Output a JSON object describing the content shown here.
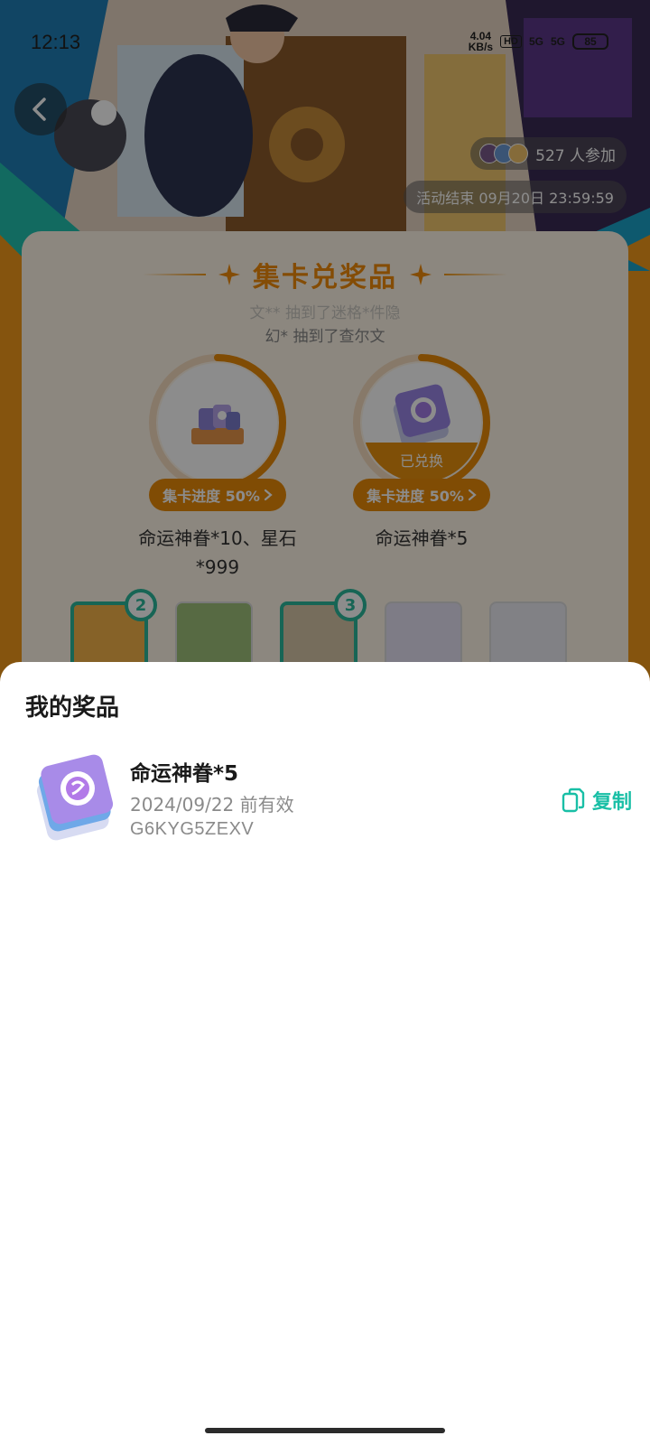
{
  "status_bar": {
    "time": "12:13",
    "net_speed": "4.04",
    "net_unit": "KB/s",
    "hd": "HD",
    "signal1": "5G",
    "signal2": "5G",
    "battery": "85"
  },
  "header": {
    "participants": "527 人参加",
    "end_time": "活动结束 09月20日 23:59:59"
  },
  "card": {
    "title": "集卡兑奖品",
    "marquee_line1": "文** 抽到了迷格*件隐",
    "marquee_line2": "幻* 抽到了查尔文",
    "prizes": [
      {
        "progress": "集卡进度 50%",
        "name": "命运神眷*10、星石*999",
        "fill": 0.5,
        "redeemed": ""
      },
      {
        "progress": "集卡进度 50%",
        "name": "命运神眷*5",
        "fill": 0.5,
        "redeemed": "已兑换"
      }
    ],
    "thumb_badges": [
      "2",
      "3"
    ]
  },
  "sheet": {
    "title": "我的奖品",
    "item": {
      "name": "命运神眷*5",
      "expiry": "2024/09/22 前有效",
      "code": "G6KYG5ZEXV",
      "copy_label": "复制"
    }
  },
  "colors": {
    "accent_orange": "#f08a0a",
    "accent_teal": "#19bfa6",
    "overlay": "rgba(0,0,0,0.45)"
  },
  "icons": [
    "back-chevron-icon",
    "copy-icon",
    "chevron-right-icon",
    "star-sparkle-icon"
  ]
}
